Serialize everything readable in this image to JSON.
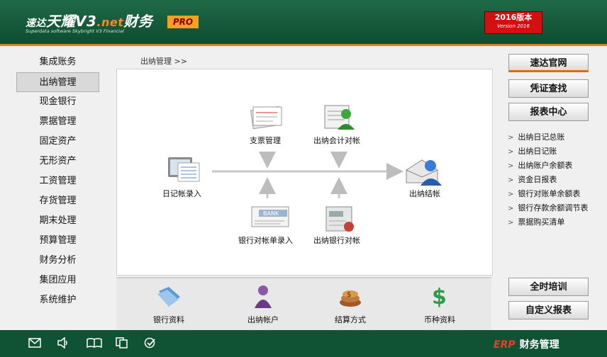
{
  "header": {
    "logo_prefix": "速达",
    "logo_name": "天耀V3",
    "logo_net": ".net",
    "logo_suffix": "财务",
    "logo_sub": "Superdata software Skybright V3 Financial",
    "pro_badge": "PRO",
    "version_line1": "2016版本",
    "version_line2": "Version 2016",
    "colors": {
      "header_bg": "#0d4d31",
      "accent": "#f07a1a",
      "badge_red": "#d21010"
    }
  },
  "nav": {
    "items": [
      {
        "label": "集成账务"
      },
      {
        "label": "出纳管理"
      },
      {
        "label": "现金银行"
      },
      {
        "label": "票据管理"
      },
      {
        "label": "固定资产"
      },
      {
        "label": "无形资产"
      },
      {
        "label": "工资管理"
      },
      {
        "label": "存货管理"
      },
      {
        "label": "期末处理"
      },
      {
        "label": "预算管理"
      },
      {
        "label": "财务分析"
      },
      {
        "label": "集团应用"
      },
      {
        "label": "系统维护"
      }
    ],
    "active_index": 1
  },
  "breadcrumb": "出纳管理 >>",
  "flow": {
    "journal_entry": "日记帐录入",
    "cheque_mgmt": "支票管理",
    "cashier_acct_reconcile": "出纳会计对帐",
    "cashier_close": "出纳结帐",
    "bank_statement_entry": "银行对帐单录入",
    "cashier_bank_reconcile": "出纳银行对帐",
    "bank_badge": "BANK"
  },
  "bottom": {
    "bank_info": "银行资料",
    "cashier_account": "出纳帐户",
    "settlement": "结算方式",
    "currency": "币种资料"
  },
  "right": {
    "buttons": [
      "速达官网",
      "凭证查找",
      "报表中心"
    ],
    "links": [
      "出纳日记总账",
      "出纳日记账",
      "出纳账户余额表",
      "资金日报表",
      "银行对账单余额表",
      "银行存款余额调节表",
      "票据购买清单"
    ],
    "bottom_buttons": [
      "全时培训",
      "自定义报表"
    ]
  },
  "footer": {
    "icons": [
      "mail-icon",
      "speaker-icon",
      "book-icon",
      "copy-icon",
      "check-circle-icon"
    ],
    "brand_erp": "ERP",
    "brand_text": "财务管理"
  }
}
